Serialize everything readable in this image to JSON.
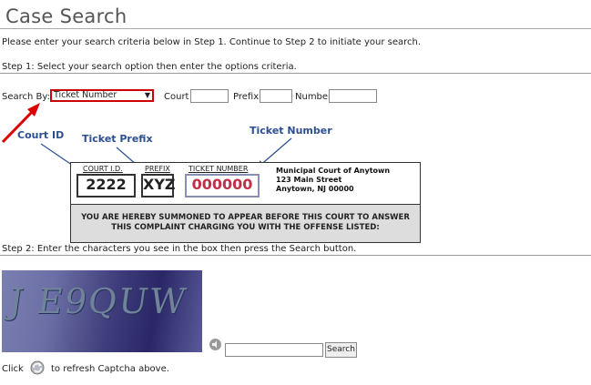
{
  "header": {
    "title": "Case Search"
  },
  "intro": "Please enter your search criteria below in Step 1. Continue to Step 2 to initiate your search.",
  "step1": {
    "heading": "Step 1: Select your search option then enter the options criteria.",
    "search_by_label": "Search By:",
    "search_by_value": "Ticket Number",
    "court_label": "Court",
    "prefix_label": "Prefix",
    "number_label": "Number",
    "court_value": "",
    "prefix_value": "",
    "number_value": ""
  },
  "annotations": {
    "court_id": "Court ID",
    "ticket_prefix": "Ticket Prefix",
    "ticket_number": "Ticket Number"
  },
  "ticket": {
    "court_label": "COURT I.D.",
    "prefix_label": "PREFIX",
    "number_label": "TICKET NUMBER",
    "court_value": "2222",
    "prefix_value": "XYZ",
    "number_value": "000000",
    "court_name": "Municipal Court of Anytown",
    "street": "123 Main Street",
    "city": "Anytown, NJ  00000",
    "summons_line1": "YOU ARE HEREBY SUMMONED TO APPEAR BEFORE THIS COURT TO ANSWER",
    "summons_line2": "THIS COMPLAINT CHARGING YOU WITH THE OFFENSE LISTED:"
  },
  "step2": {
    "heading": "Step 2: Enter the characters you see in the box then press the Search button.",
    "captcha_text": "J E9QUW",
    "captcha_value": "",
    "search_button": "Search",
    "refresh_prefix": "Click",
    "refresh_suffix": "to refresh Captcha above."
  },
  "colors": {
    "accent_red": "#cc0000",
    "annotation_blue": "#2d4f8f",
    "ticket_number_red": "#c0304a"
  },
  "icons": [
    "audio-icon",
    "refresh-icon",
    "red-arrow",
    "select-chevron-icon"
  ]
}
